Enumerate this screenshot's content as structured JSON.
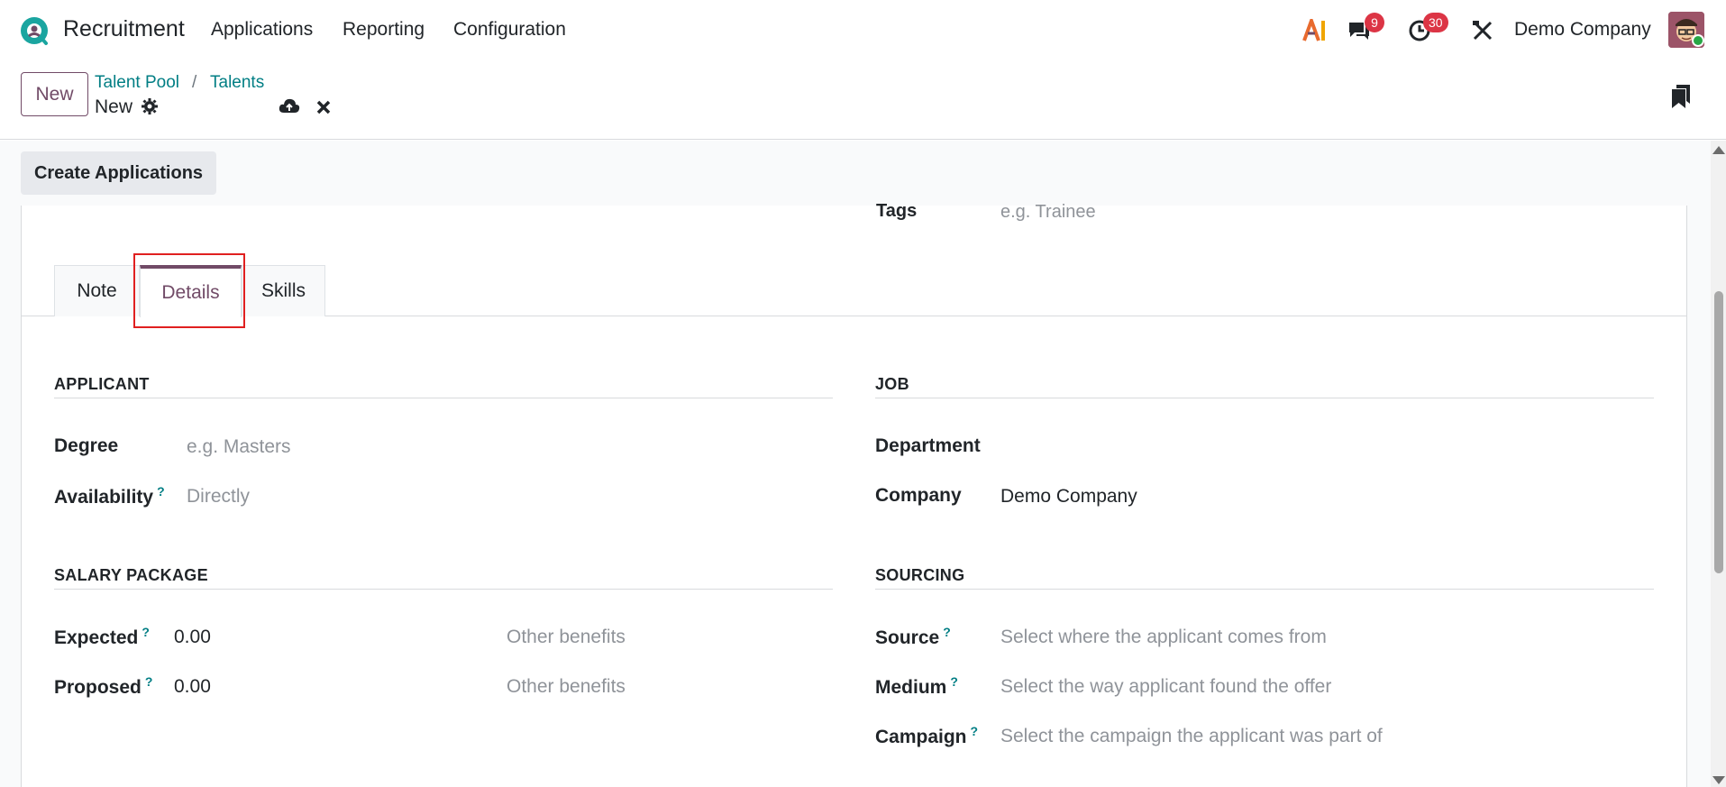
{
  "navbar": {
    "app_name": "Recruitment",
    "menus": [
      "Applications",
      "Reporting",
      "Configuration"
    ],
    "messages_count": "9",
    "activities_count": "30",
    "company": "Demo Company"
  },
  "control": {
    "new_button": "New",
    "breadcrumbs": [
      "Talent Pool",
      "Talents"
    ],
    "separator": "/",
    "record_name": "New"
  },
  "actions": {
    "create_applications": "Create Applications"
  },
  "form": {
    "tags_label": "Tags",
    "tags_placeholder": "e.g. Trainee",
    "tabs": [
      "Note",
      "Details",
      "Skills"
    ],
    "active_tab": "Details",
    "applicant": {
      "title": "APPLICANT",
      "degree_label": "Degree",
      "degree_placeholder": "e.g. Masters",
      "availability_label": "Availability",
      "availability_placeholder": "Directly"
    },
    "job": {
      "title": "JOB",
      "department_label": "Department",
      "company_label": "Company",
      "company_value": "Demo Company"
    },
    "salary": {
      "title": "SALARY PACKAGE",
      "expected_label": "Expected",
      "expected_value": "0.00",
      "expected_benefits_placeholder": "Other benefits",
      "proposed_label": "Proposed",
      "proposed_value": "0.00",
      "proposed_benefits_placeholder": "Other benefits"
    },
    "sourcing": {
      "title": "SOURCING",
      "source_label": "Source",
      "source_placeholder": "Select where the applicant comes from",
      "medium_label": "Medium",
      "medium_placeholder": "Select the way applicant found the offer",
      "campaign_label": "Campaign",
      "campaign_placeholder": "Select the campaign the applicant was part of"
    },
    "help_mark": "?"
  },
  "colors": {
    "brand": "#714b67",
    "link": "#017e84",
    "badge": "#dc3545",
    "highlight": "#e02020"
  }
}
